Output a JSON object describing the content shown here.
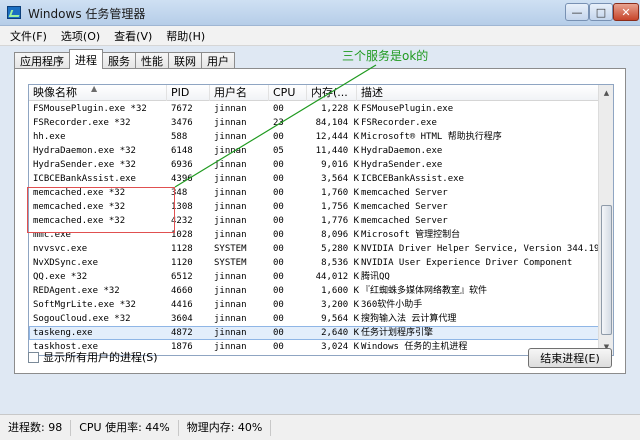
{
  "window": {
    "title": "Windows 任务管理器",
    "min_glyph": "—",
    "max_glyph": "□",
    "close_glyph": "✕"
  },
  "menu": [
    "文件(F)",
    "选项(O)",
    "查看(V)",
    "帮助(H)"
  ],
  "tabs": [
    "应用程序",
    "进程",
    "服务",
    "性能",
    "联网",
    "用户"
  ],
  "active_tab": "进程",
  "columns": {
    "name": "映像名称",
    "pid": "PID",
    "user": "用户名",
    "cpu": "CPU",
    "mem": "内存(...",
    "desc": "描述"
  },
  "sort_arrow": "▲",
  "processes": [
    {
      "name": "FSMousePlugin.exe *32",
      "pid": "7672",
      "user": "jinnan",
      "cpu": "00",
      "mem": "1,228 K",
      "desc": "FSMousePlugin.exe"
    },
    {
      "name": "FSRecorder.exe *32",
      "pid": "3476",
      "user": "jinnan",
      "cpu": "23",
      "mem": "84,104 K",
      "desc": "FSRecorder.exe"
    },
    {
      "name": "hh.exe",
      "pid": "588",
      "user": "jinnan",
      "cpu": "00",
      "mem": "12,444 K",
      "desc": "Microsoft® HTML 帮助执行程序"
    },
    {
      "name": "HydraDaemon.exe *32",
      "pid": "6148",
      "user": "jinnan",
      "cpu": "05",
      "mem": "11,440 K",
      "desc": "HydraDaemon.exe"
    },
    {
      "name": "HydraSender.exe *32",
      "pid": "6936",
      "user": "jinnan",
      "cpu": "00",
      "mem": "9,016 K",
      "desc": "HydraSender.exe"
    },
    {
      "name": "ICBCEBankAssist.exe",
      "pid": "4396",
      "user": "jinnan",
      "cpu": "00",
      "mem": "3,564 K",
      "desc": "ICBCEBankAssist.exe"
    },
    {
      "name": "memcached.exe *32",
      "pid": "348",
      "user": "jinnan",
      "cpu": "00",
      "mem": "1,760 K",
      "desc": "memcached Server"
    },
    {
      "name": "memcached.exe *32",
      "pid": "1308",
      "user": "jinnan",
      "cpu": "00",
      "mem": "1,756 K",
      "desc": "memcached Server"
    },
    {
      "name": "memcached.exe *32",
      "pid": "4232",
      "user": "jinnan",
      "cpu": "00",
      "mem": "1,776 K",
      "desc": "memcached Server"
    },
    {
      "name": "mmc.exe",
      "pid": "1028",
      "user": "jinnan",
      "cpu": "00",
      "mem": "8,096 K",
      "desc": "Microsoft 管理控制台"
    },
    {
      "name": "nvvsvc.exe",
      "pid": "1128",
      "user": "SYSTEM",
      "cpu": "00",
      "mem": "5,280 K",
      "desc": "NVIDIA Driver Helper Service, Version 344.19"
    },
    {
      "name": "NvXDSync.exe",
      "pid": "1120",
      "user": "SYSTEM",
      "cpu": "00",
      "mem": "8,536 K",
      "desc": "NVIDIA User Experience Driver Component"
    },
    {
      "name": "QQ.exe *32",
      "pid": "6512",
      "user": "jinnan",
      "cpu": "00",
      "mem": "44,012 K",
      "desc": "腾讯QQ"
    },
    {
      "name": "REDAgent.exe *32",
      "pid": "4660",
      "user": "jinnan",
      "cpu": "00",
      "mem": "1,600 K",
      "desc": "『红蜘蛛多媒体网络教室』软件"
    },
    {
      "name": "SoftMgrLite.exe *32",
      "pid": "4416",
      "user": "jinnan",
      "cpu": "00",
      "mem": "3,200 K",
      "desc": "360软件小助手"
    },
    {
      "name": "SogouCloud.exe *32",
      "pid": "3604",
      "user": "jinnan",
      "cpu": "00",
      "mem": "9,564 K",
      "desc": "搜狗输入法 云计算代理"
    },
    {
      "name": "taskeng.exe",
      "pid": "4872",
      "user": "jinnan",
      "cpu": "00",
      "mem": "2,640 K",
      "desc": "任务计划程序引擎",
      "selected": true
    },
    {
      "name": "taskhost.exe",
      "pid": "1876",
      "user": "jinnan",
      "cpu": "00",
      "mem": "3,024 K",
      "desc": "Windows 任务的主机进程"
    }
  ],
  "annotation": "三个服务是ok的",
  "show_all_users": "显示所有用户的进程(S)",
  "end_process": "结束进程(E)",
  "status": {
    "processes": "进程数: 98",
    "cpu": "CPU 使用率: 44%",
    "memory": "物理内存: 40%"
  },
  "colors": {
    "annotation": "#1f9a1f",
    "highlight": "#e05050",
    "selection": "#e3eefb"
  }
}
